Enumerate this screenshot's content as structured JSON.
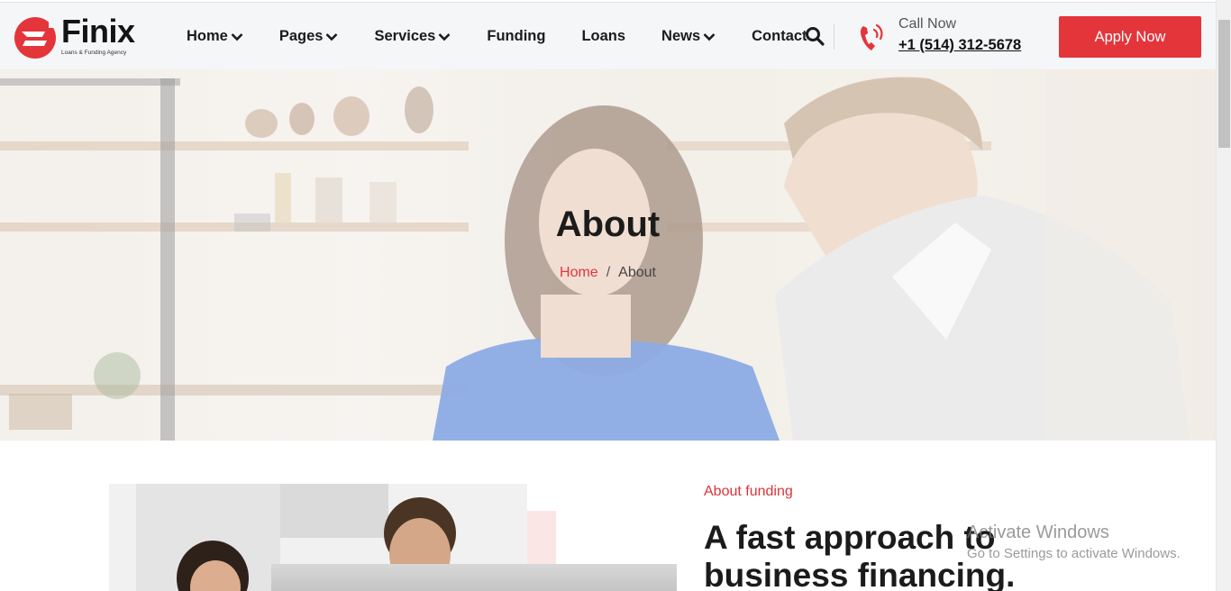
{
  "brand": {
    "name": "Finix",
    "tagline": "Loans & Funding Agency",
    "accent_color": "#e4353b"
  },
  "nav": {
    "items": [
      {
        "label": "Home",
        "has_dropdown": true
      },
      {
        "label": "Pages",
        "has_dropdown": true
      },
      {
        "label": "Services",
        "has_dropdown": true
      },
      {
        "label": "Funding",
        "has_dropdown": false
      },
      {
        "label": "Loans",
        "has_dropdown": false
      },
      {
        "label": "News",
        "has_dropdown": true
      },
      {
        "label": "Contact",
        "has_dropdown": false
      }
    ],
    "search_icon": "search-icon"
  },
  "contact": {
    "call_label": "Call Now",
    "phone": "+1 (514) 312-5678",
    "phone_icon": "phone-ringing-icon"
  },
  "cta": {
    "apply_label": "Apply Now"
  },
  "hero": {
    "title": "About",
    "breadcrumb": {
      "home": "Home",
      "separator": "/",
      "current": "About"
    }
  },
  "about": {
    "subtitle": "About funding",
    "title": "A fast approach to business financing."
  },
  "watermark": {
    "line1": "Activate Windows",
    "line2": "Go to Settings to activate Windows."
  }
}
